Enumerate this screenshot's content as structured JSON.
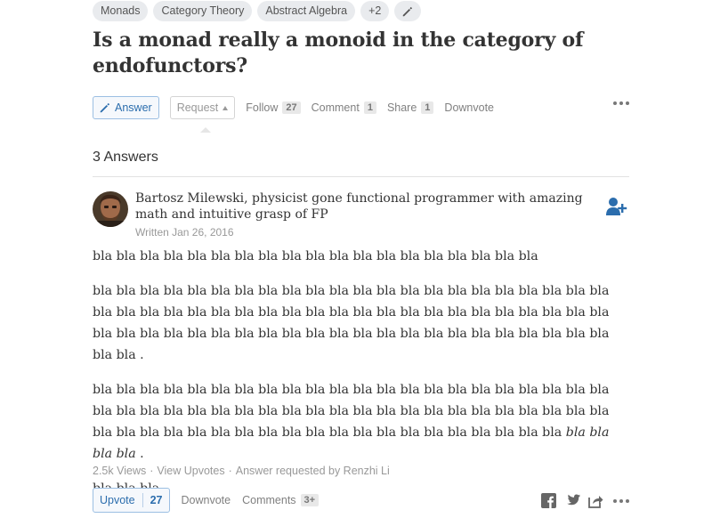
{
  "topics": {
    "items": [
      "Monads",
      "Category Theory",
      "Abstract Algebra",
      "+2"
    ]
  },
  "question": {
    "title": "Is a monad really a monoid in the category of endofunctors?"
  },
  "actions": {
    "answer_label": "Answer",
    "request_label": "Request",
    "follow_label": "Follow",
    "follow_count": "27",
    "comment_label": "Comment",
    "comment_count": "1",
    "share_label": "Share",
    "share_count": "1",
    "downvote_label": "Downvote"
  },
  "answers_header": "3 Answers",
  "answer": {
    "author": "Bartosz Milewski, physicist gone functional programmer with amazing math and intuitive grasp of FP",
    "written": "Written Jan 26, 2016",
    "p1": "bla bla bla bla bla bla bla bla bla bla bla bla bla bla bla bla bla bla bla",
    "p2": "bla bla bla bla bla bla bla bla bla bla bla bla bla bla bla bla bla bla bla bla bla bla bla bla bla bla bla bla bla bla bla bla bla bla bla bla bla bla bla bla bla bla bla bla bla bla bla bla bla bla bla bla bla bla bla bla bla bla bla bla bla bla bla bla bla bla bla bla .",
    "p3_regular": "bla bla bla bla bla bla bla bla bla bla bla bla bla bla bla bla bla bla bla bla bla bla bla bla bla bla bla bla bla bla bla bla bla bla bla bla bla bla bla bla bla bla bla bla bla bla bla bla bla bla bla bla bla bla bla bla bla bla bla bla bla bla bla bla",
    "p3_italic": "bla bla bla bla",
    "p3_end": " .",
    "p4": "bla bla bla",
    "views": "2.5k Views",
    "view_upvotes": "View Upvotes",
    "requested_by": "Answer requested by Renzhi Li",
    "upvote_label": "Upvote",
    "upvote_count": "27",
    "downvote_label": "Downvote",
    "comments_label": "Comments",
    "comments_count": "3+"
  },
  "colors": {
    "accent_blue": "#2b6dad",
    "text": "#333333",
    "muted": "#999999"
  },
  "icons": [
    "pencil-icon",
    "caret-up-icon",
    "more-icon",
    "follow-user-icon",
    "facebook-icon",
    "twitter-icon",
    "share-icon"
  ]
}
